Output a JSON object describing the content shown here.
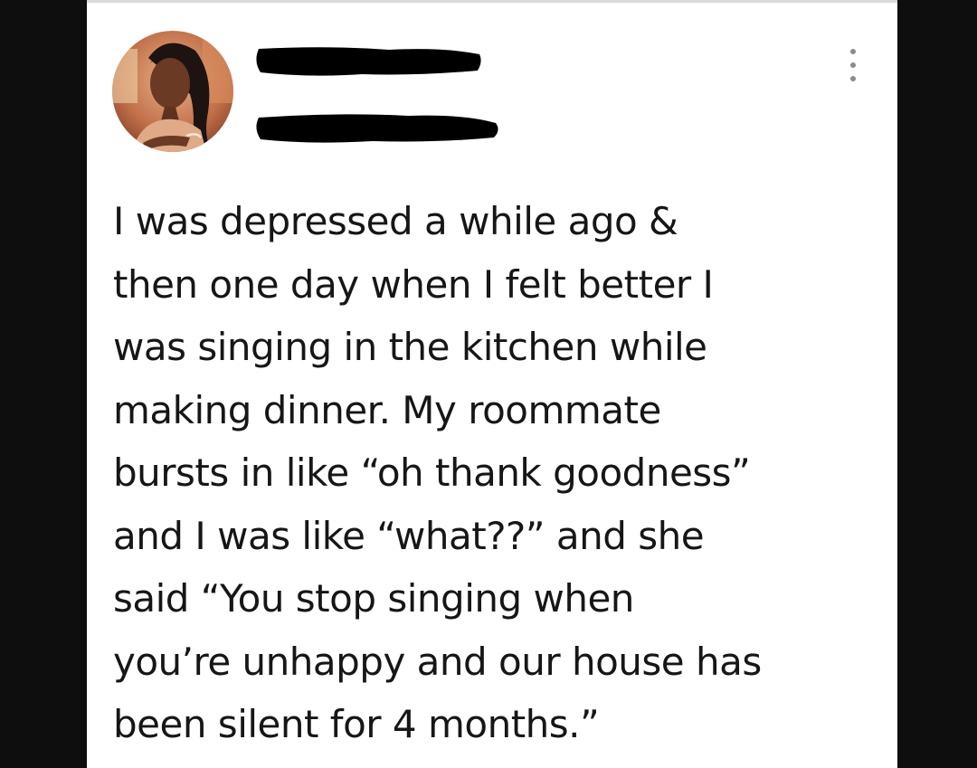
{
  "post": {
    "more_icon": "more-vertical-icon",
    "lines": [
      "I was depressed a while ago &",
      "then one day when I felt better I",
      "was singing in the kitchen while",
      "making dinner. My roommate",
      "bursts in like “oh thank goodness”",
      "and I was like “what??” and she",
      "said “You stop singing when",
      "you’re unhappy and our house has",
      "been silent for 4 months.”"
    ]
  },
  "colors": {
    "background": "#0e0e0e",
    "card": "#ffffff",
    "text": "#161616",
    "redaction": "#000000",
    "more_dots": "#8c8c8c"
  }
}
